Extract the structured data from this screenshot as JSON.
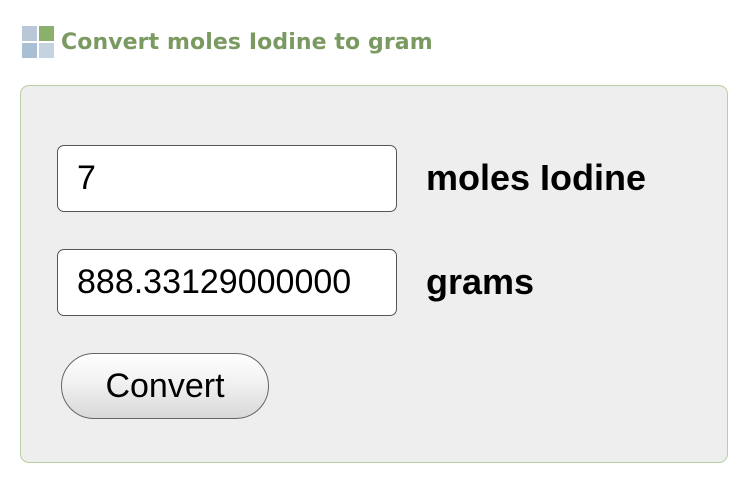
{
  "header": {
    "icon": "grid-logo-icon",
    "title": "Convert moles Iodine to gram"
  },
  "form": {
    "moles_value": "7",
    "moles_unit": "moles Iodine",
    "grams_value": "888.33129000000",
    "grams_unit": "grams",
    "convert_label": "Convert"
  },
  "colors": {
    "title": "#7a9a62",
    "panel_background": "#eeeeee",
    "panel_border": "#b6cfa3"
  }
}
